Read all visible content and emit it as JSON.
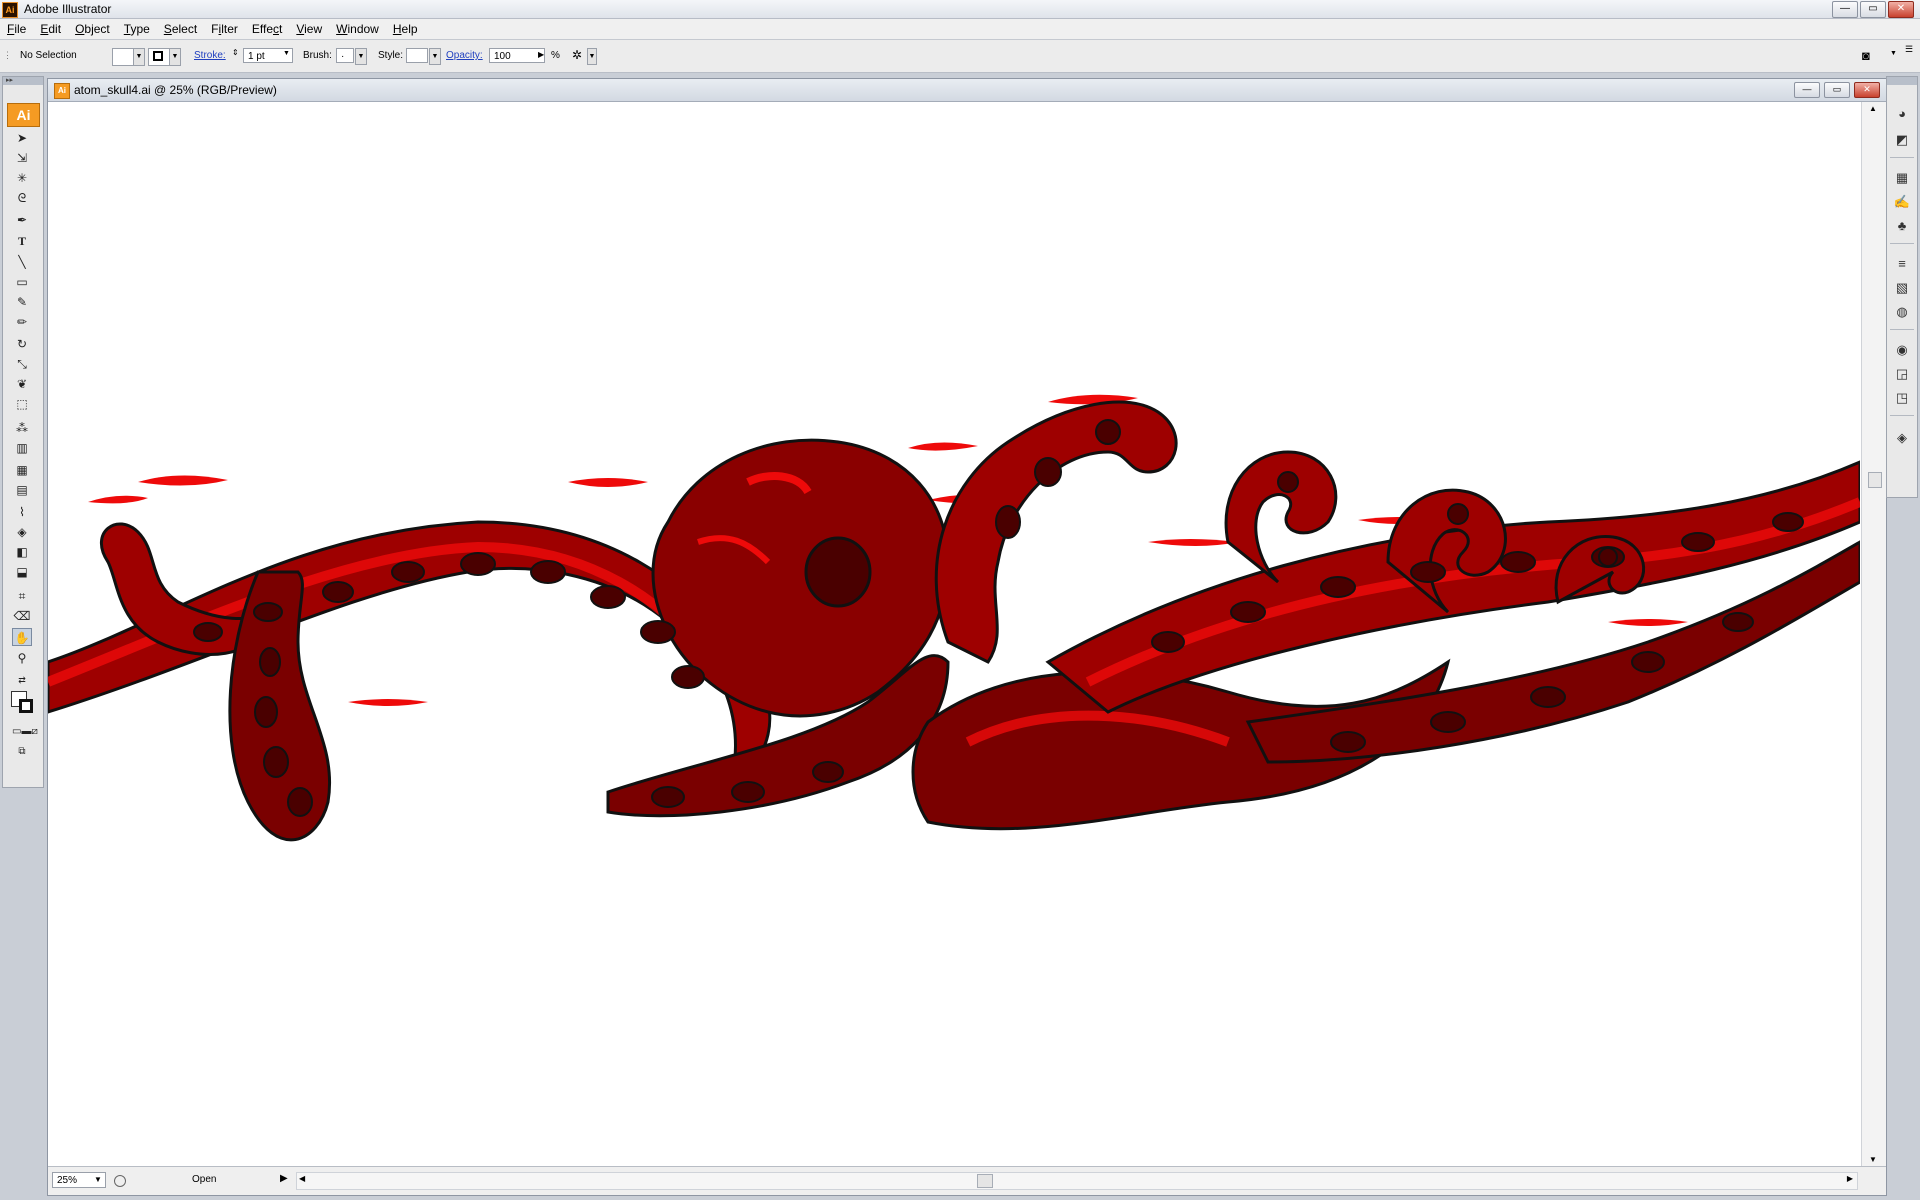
{
  "app": {
    "icon_text": "Ai",
    "title": "Adobe Illustrator",
    "window_buttons": [
      "—",
      "▭",
      "✕"
    ]
  },
  "menu": {
    "items": [
      {
        "pre": "",
        "u": "F",
        "post": "ile"
      },
      {
        "pre": "",
        "u": "E",
        "post": "dit"
      },
      {
        "pre": "",
        "u": "O",
        "post": "bject"
      },
      {
        "pre": "",
        "u": "T",
        "post": "ype"
      },
      {
        "pre": "",
        "u": "S",
        "post": "elect"
      },
      {
        "pre": "F",
        "u": "i",
        "post": "lter"
      },
      {
        "pre": "Effe",
        "u": "c",
        "post": "t"
      },
      {
        "pre": "",
        "u": "V",
        "post": "iew"
      },
      {
        "pre": "",
        "u": "W",
        "post": "indow"
      },
      {
        "pre": "",
        "u": "H",
        "post": "elp"
      }
    ]
  },
  "control": {
    "selection": "No Selection",
    "stroke_label": "Stroke:",
    "stroke_value": "1 pt",
    "brush_label": "Brush:",
    "brush_value": "·",
    "style_label": "Style:",
    "opacity_label": "Opacity:",
    "opacity_value": "100",
    "percent": "%"
  },
  "tools": {
    "logo": "Ai"
  },
  "document": {
    "icon_text": "Ai",
    "title": "atom_skull4.ai @ 25% (RGB/Preview)",
    "zoom": "25%",
    "status": "Open"
  },
  "colors": {
    "artwork_dark": "#6a0000",
    "artwork_mid": "#9e0000",
    "artwork_bright": "#ee0a0a",
    "outline": "#111111"
  }
}
